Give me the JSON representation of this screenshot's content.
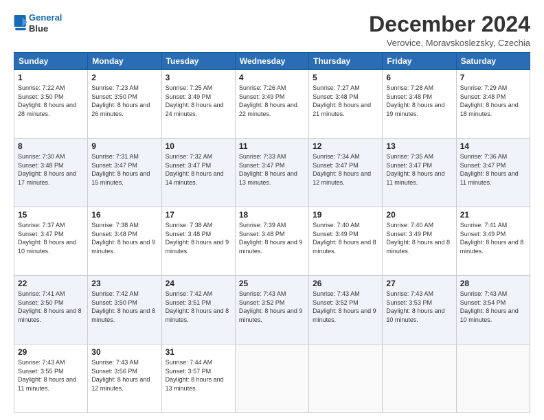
{
  "header": {
    "logo_line1": "General",
    "logo_line2": "Blue",
    "month_title": "December 2024",
    "location": "Verovice, Moravskoslezsky, Czechia"
  },
  "weekdays": [
    "Sunday",
    "Monday",
    "Tuesday",
    "Wednesday",
    "Thursday",
    "Friday",
    "Saturday"
  ],
  "weeks": [
    [
      {
        "day": "1",
        "sunrise": "Sunrise: 7:22 AM",
        "sunset": "Sunset: 3:50 PM",
        "daylight": "Daylight: 8 hours and 28 minutes."
      },
      {
        "day": "2",
        "sunrise": "Sunrise: 7:23 AM",
        "sunset": "Sunset: 3:50 PM",
        "daylight": "Daylight: 8 hours and 26 minutes."
      },
      {
        "day": "3",
        "sunrise": "Sunrise: 7:25 AM",
        "sunset": "Sunset: 3:49 PM",
        "daylight": "Daylight: 8 hours and 24 minutes."
      },
      {
        "day": "4",
        "sunrise": "Sunrise: 7:26 AM",
        "sunset": "Sunset: 3:49 PM",
        "daylight": "Daylight: 8 hours and 22 minutes."
      },
      {
        "day": "5",
        "sunrise": "Sunrise: 7:27 AM",
        "sunset": "Sunset: 3:48 PM",
        "daylight": "Daylight: 8 hours and 21 minutes."
      },
      {
        "day": "6",
        "sunrise": "Sunrise: 7:28 AM",
        "sunset": "Sunset: 3:48 PM",
        "daylight": "Daylight: 8 hours and 19 minutes."
      },
      {
        "day": "7",
        "sunrise": "Sunrise: 7:29 AM",
        "sunset": "Sunset: 3:48 PM",
        "daylight": "Daylight: 8 hours and 18 minutes."
      }
    ],
    [
      {
        "day": "8",
        "sunrise": "Sunrise: 7:30 AM",
        "sunset": "Sunset: 3:48 PM",
        "daylight": "Daylight: 8 hours and 17 minutes."
      },
      {
        "day": "9",
        "sunrise": "Sunrise: 7:31 AM",
        "sunset": "Sunset: 3:47 PM",
        "daylight": "Daylight: 8 hours and 15 minutes."
      },
      {
        "day": "10",
        "sunrise": "Sunrise: 7:32 AM",
        "sunset": "Sunset: 3:47 PM",
        "daylight": "Daylight: 8 hours and 14 minutes."
      },
      {
        "day": "11",
        "sunrise": "Sunrise: 7:33 AM",
        "sunset": "Sunset: 3:47 PM",
        "daylight": "Daylight: 8 hours and 13 minutes."
      },
      {
        "day": "12",
        "sunrise": "Sunrise: 7:34 AM",
        "sunset": "Sunset: 3:47 PM",
        "daylight": "Daylight: 8 hours and 12 minutes."
      },
      {
        "day": "13",
        "sunrise": "Sunrise: 7:35 AM",
        "sunset": "Sunset: 3:47 PM",
        "daylight": "Daylight: 8 hours and 11 minutes."
      },
      {
        "day": "14",
        "sunrise": "Sunrise: 7:36 AM",
        "sunset": "Sunset: 3:47 PM",
        "daylight": "Daylight: 8 hours and 11 minutes."
      }
    ],
    [
      {
        "day": "15",
        "sunrise": "Sunrise: 7:37 AM",
        "sunset": "Sunset: 3:47 PM",
        "daylight": "Daylight: 8 hours and 10 minutes."
      },
      {
        "day": "16",
        "sunrise": "Sunrise: 7:38 AM",
        "sunset": "Sunset: 3:48 PM",
        "daylight": "Daylight: 8 hours and 9 minutes."
      },
      {
        "day": "17",
        "sunrise": "Sunrise: 7:38 AM",
        "sunset": "Sunset: 3:48 PM",
        "daylight": "Daylight: 8 hours and 9 minutes."
      },
      {
        "day": "18",
        "sunrise": "Sunrise: 7:39 AM",
        "sunset": "Sunset: 3:48 PM",
        "daylight": "Daylight: 8 hours and 9 minutes."
      },
      {
        "day": "19",
        "sunrise": "Sunrise: 7:40 AM",
        "sunset": "Sunset: 3:49 PM",
        "daylight": "Daylight: 8 hours and 8 minutes."
      },
      {
        "day": "20",
        "sunrise": "Sunrise: 7:40 AM",
        "sunset": "Sunset: 3:49 PM",
        "daylight": "Daylight: 8 hours and 8 minutes."
      },
      {
        "day": "21",
        "sunrise": "Sunrise: 7:41 AM",
        "sunset": "Sunset: 3:49 PM",
        "daylight": "Daylight: 8 hours and 8 minutes."
      }
    ],
    [
      {
        "day": "22",
        "sunrise": "Sunrise: 7:41 AM",
        "sunset": "Sunset: 3:50 PM",
        "daylight": "Daylight: 8 hours and 8 minutes."
      },
      {
        "day": "23",
        "sunrise": "Sunrise: 7:42 AM",
        "sunset": "Sunset: 3:50 PM",
        "daylight": "Daylight: 8 hours and 8 minutes."
      },
      {
        "day": "24",
        "sunrise": "Sunrise: 7:42 AM",
        "sunset": "Sunset: 3:51 PM",
        "daylight": "Daylight: 8 hours and 8 minutes."
      },
      {
        "day": "25",
        "sunrise": "Sunrise: 7:43 AM",
        "sunset": "Sunset: 3:52 PM",
        "daylight": "Daylight: 8 hours and 9 minutes."
      },
      {
        "day": "26",
        "sunrise": "Sunrise: 7:43 AM",
        "sunset": "Sunset: 3:52 PM",
        "daylight": "Daylight: 8 hours and 9 minutes."
      },
      {
        "day": "27",
        "sunrise": "Sunrise: 7:43 AM",
        "sunset": "Sunset: 3:53 PM",
        "daylight": "Daylight: 8 hours and 10 minutes."
      },
      {
        "day": "28",
        "sunrise": "Sunrise: 7:43 AM",
        "sunset": "Sunset: 3:54 PM",
        "daylight": "Daylight: 8 hours and 10 minutes."
      }
    ],
    [
      {
        "day": "29",
        "sunrise": "Sunrise: 7:43 AM",
        "sunset": "Sunset: 3:55 PM",
        "daylight": "Daylight: 8 hours and 11 minutes."
      },
      {
        "day": "30",
        "sunrise": "Sunrise: 7:43 AM",
        "sunset": "Sunset: 3:56 PM",
        "daylight": "Daylight: 8 hours and 12 minutes."
      },
      {
        "day": "31",
        "sunrise": "Sunrise: 7:44 AM",
        "sunset": "Sunset: 3:57 PM",
        "daylight": "Daylight: 8 hours and 13 minutes."
      },
      null,
      null,
      null,
      null
    ]
  ]
}
